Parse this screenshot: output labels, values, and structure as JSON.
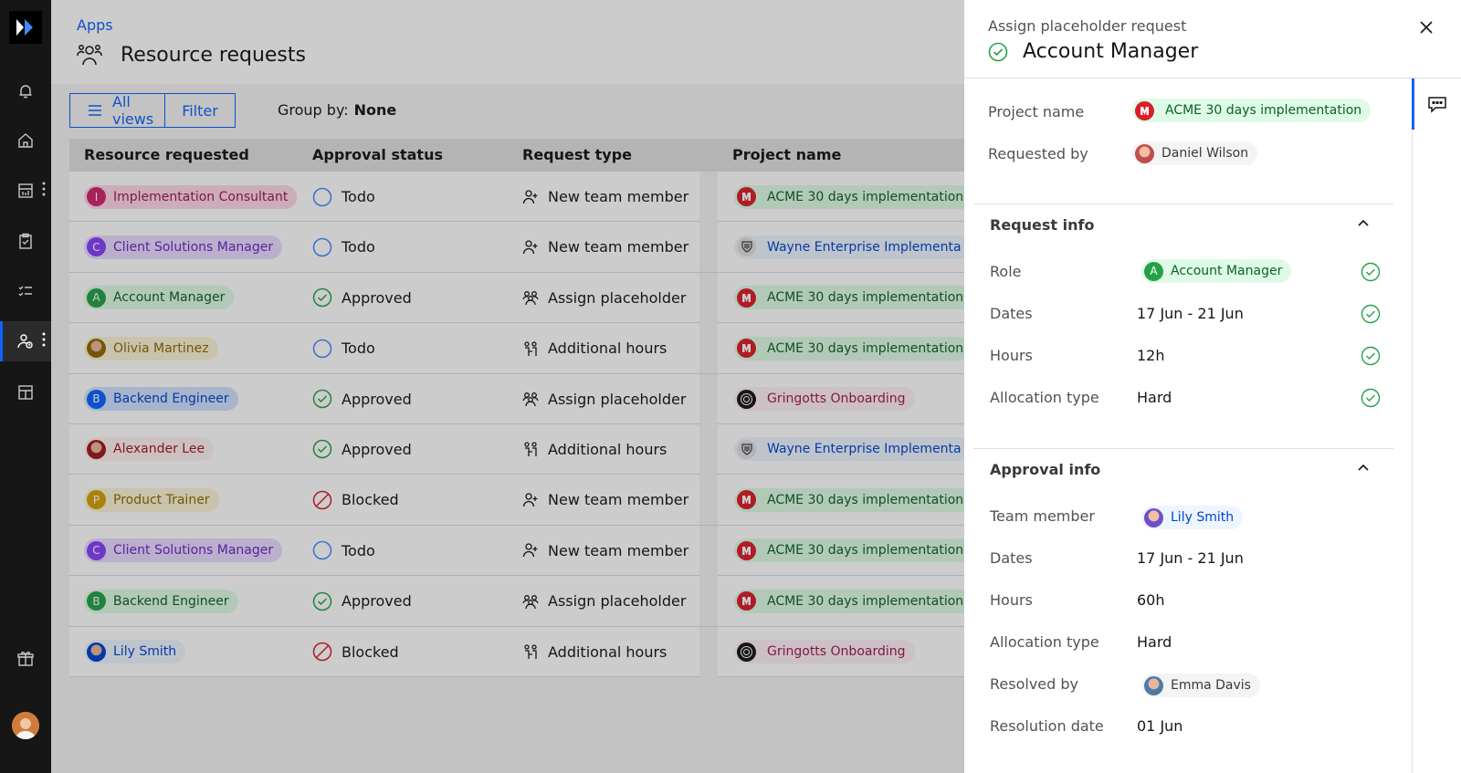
{
  "nav": {
    "items": [
      "notification",
      "home",
      "reports",
      "tasks",
      "checklist",
      "resource-requests",
      "apps-grid"
    ],
    "active": "resource-requests"
  },
  "header": {
    "breadcrumb": "Apps",
    "title": "Resource requests"
  },
  "toolbar": {
    "all_views": "All views",
    "filter": "Filter",
    "group_by_label": "Group by:",
    "group_by_value": "None"
  },
  "table": {
    "columns": [
      "Resource requested",
      "Approval status",
      "Request type",
      "Project name"
    ],
    "rows": [
      {
        "resource": "Implementation Consultant",
        "initial": "I",
        "status": "Todo",
        "type": "New team member",
        "project": "ACME 30 days implementation"
      },
      {
        "resource": "Client Solutions Manager",
        "initial": "C",
        "status": "Todo",
        "type": "New team member",
        "project": "Wayne Enterprise Implementa"
      },
      {
        "resource": "Account Manager",
        "initial": "A",
        "status": "Approved",
        "type": "Assign placeholder",
        "project": "ACME 30 days implementation"
      },
      {
        "resource": "Olivia Martinez",
        "initial": "",
        "status": "Todo",
        "type": "Additional hours",
        "project": "ACME 30 days implementation"
      },
      {
        "resource": "Backend Engineer",
        "initial": "B",
        "status": "Approved",
        "type": "Assign placeholder",
        "project": "Gringotts Onboarding"
      },
      {
        "resource": "Alexander Lee",
        "initial": "",
        "status": "Approved",
        "type": "Additional hours",
        "project": "Wayne Enterprise Implementa"
      },
      {
        "resource": "Product Trainer",
        "initial": "P",
        "status": "Blocked",
        "type": "New team member",
        "project": "ACME 30 days implementation"
      },
      {
        "resource": "Client Solutions Manager",
        "initial": "C",
        "status": "Todo",
        "type": "New team member",
        "project": "ACME 30 days implementation"
      },
      {
        "resource": "Backend Engineer",
        "initial": "B",
        "status": "Approved",
        "type": "Assign placeholder",
        "project": "ACME 30 days implementation"
      },
      {
        "resource": "Lily Smith",
        "initial": "",
        "status": "Blocked",
        "type": "Additional hours",
        "project": "Gringotts Onboarding"
      }
    ]
  },
  "panel": {
    "subtitle": "Assign placeholder request",
    "title": "Account Manager",
    "project_label": "Project name",
    "project_value": "ACME 30 days implementation",
    "requested_by_label": "Requested by",
    "requested_by_value": "Daniel Wilson",
    "request_info": {
      "title": "Request info",
      "role_label": "Role",
      "role_initial": "A",
      "role_value": "Account Manager",
      "dates_label": "Dates",
      "dates_value": "17 Jun - 21 Jun",
      "hours_label": "Hours",
      "hours_value": "12h",
      "alloc_label": "Allocation type",
      "alloc_value": "Hard"
    },
    "approval_info": {
      "title": "Approval info",
      "member_label": "Team member",
      "member_value": "Lily Smith",
      "dates_label": "Dates",
      "dates_value": "17 Jun - 21 Jun",
      "hours_label": "Hours",
      "hours_value": "60h",
      "alloc_label": "Allocation type",
      "alloc_value": "Hard",
      "resolved_label": "Resolved by",
      "resolved_value": "Emma Davis",
      "resolution_date_label": "Resolution date",
      "resolution_date_value": "01 Jun"
    }
  },
  "colors": {
    "accent": "#0f62fe",
    "approved": "#24a148",
    "blocked": "#da1e28",
    "todo": "#4589ff"
  }
}
